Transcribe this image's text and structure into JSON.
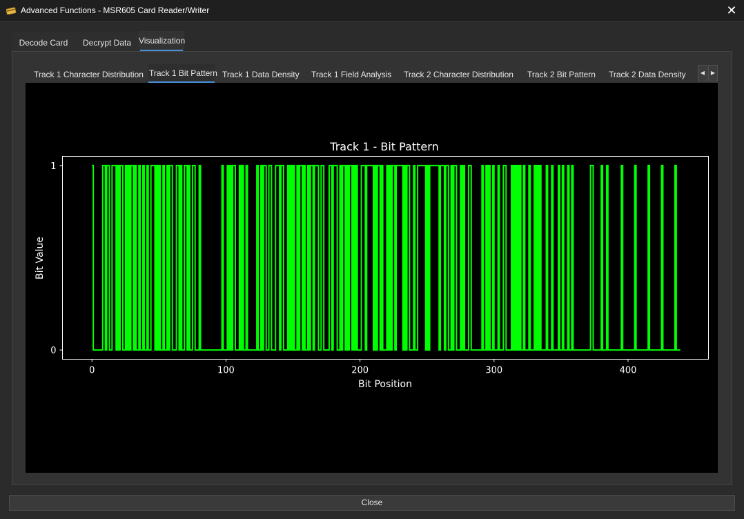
{
  "window": {
    "title": "Advanced Functions - MSR605 Card Reader/Writer",
    "icon": "card-icon",
    "close_icon": "close-icon"
  },
  "outer_tabs": [
    {
      "label": "Decode Card"
    },
    {
      "label": "Decrypt Data"
    },
    {
      "label": "Visualization",
      "active": true
    }
  ],
  "inner_tabs": [
    {
      "label": "Track 1 Character Distribution"
    },
    {
      "label": "Track 1 Bit Pattern",
      "active": true
    },
    {
      "label": "Track 1 Data Density"
    },
    {
      "label": "Track 1 Field Analysis"
    },
    {
      "label": "Track 2 Character Distribution"
    },
    {
      "label": "Track 2 Bit Pattern"
    },
    {
      "label": "Track 2 Data Density"
    }
  ],
  "scroll_buttons": {
    "left_icon": "triangle-left-icon",
    "right_icon": "triangle-right-icon"
  },
  "footer": {
    "close_label": "Close"
  },
  "colors": {
    "line": "#00ff00",
    "background": "#000000",
    "accent": "#4a90d9"
  },
  "chart_data": {
    "type": "line",
    "step": true,
    "title": "Track 1 - Bit Pattern",
    "xlabel": "Bit Position",
    "ylabel": "Bit Value",
    "xlim": [
      -22,
      460
    ],
    "ylim": [
      -0.05,
      1.05
    ],
    "xticks": [
      0,
      100,
      200,
      300,
      400
    ],
    "yticks": [
      0,
      1
    ],
    "grid": false,
    "line_color": "#00ff00",
    "x": [
      0,
      1,
      2,
      3,
      4,
      5,
      6,
      7,
      8,
      9,
      10,
      11,
      12,
      13,
      14,
      15,
      16,
      17,
      18,
      19,
      20,
      21,
      22,
      23,
      24,
      25,
      26,
      27,
      28,
      29,
      30,
      31,
      32,
      33,
      34,
      35,
      36,
      37,
      38,
      39,
      40,
      41,
      42,
      43,
      44,
      45,
      46,
      47,
      48,
      49,
      50,
      51,
      52,
      53,
      54,
      55,
      56,
      57,
      58,
      59,
      60,
      61,
      62,
      63,
      64,
      65,
      66,
      67,
      68,
      69,
      70,
      71,
      72,
      73,
      74,
      75,
      76,
      77,
      78,
      79,
      80,
      81,
      82,
      83,
      84,
      85,
      86,
      87,
      88,
      89,
      90,
      91,
      92,
      93,
      94,
      95,
      96,
      97,
      98,
      99,
      100,
      101,
      102,
      103,
      104,
      105,
      106,
      107,
      108,
      109,
      110,
      111,
      112,
      113,
      114,
      115,
      116,
      117,
      118,
      119,
      120,
      121,
      122,
      123,
      124,
      125,
      126,
      127,
      128,
      129,
      130,
      131,
      132,
      133,
      134,
      135,
      136,
      137,
      138,
      139,
      140,
      141,
      142,
      143,
      144,
      145,
      146,
      147,
      148,
      149,
      150,
      151,
      152,
      153,
      154,
      155,
      156,
      157,
      158,
      159,
      160,
      161,
      162,
      163,
      164,
      165,
      166,
      167,
      168,
      169,
      170,
      171,
      172,
      173,
      174,
      175,
      176,
      177,
      178,
      179,
      180,
      181,
      182,
      183,
      184,
      185,
      186,
      187,
      188,
      189,
      190,
      191,
      192,
      193,
      194,
      195,
      196,
      197,
      198,
      199,
      200,
      201,
      202,
      203,
      204,
      205,
      206,
      207,
      208,
      209,
      210,
      211,
      212,
      213,
      214,
      215,
      216,
      217,
      218,
      219,
      220,
      221,
      222,
      223,
      224,
      225,
      226,
      227,
      228,
      229,
      230,
      231,
      232,
      233,
      234,
      235,
      236,
      237,
      238,
      239,
      240,
      241,
      242,
      243,
      244,
      245,
      246,
      247,
      248,
      249,
      250,
      251,
      252,
      253,
      254,
      255,
      256,
      257,
      258,
      259,
      260,
      261,
      262,
      263,
      264,
      265,
      266,
      267,
      268,
      269,
      270,
      271,
      272,
      273,
      274,
      275,
      276,
      277,
      278,
      279,
      280,
      281,
      282,
      283,
      284,
      285,
      286,
      287,
      288,
      289,
      290,
      291,
      292,
      293,
      294,
      295,
      296,
      297,
      298,
      299,
      300,
      301,
      302,
      303,
      304,
      305,
      306,
      307,
      308,
      309,
      310,
      311,
      312,
      313,
      314,
      315,
      316,
      317,
      318,
      319,
      320,
      321,
      322,
      323,
      324,
      325,
      326,
      327,
      328,
      329,
      330,
      331,
      332,
      333,
      334,
      335,
      336,
      337,
      338,
      339,
      340,
      341,
      342,
      343,
      344,
      345,
      346,
      347,
      348,
      349,
      350,
      351,
      352,
      353,
      354,
      355,
      356,
      357,
      358,
      359,
      360,
      361,
      362,
      363,
      364,
      365,
      366,
      367,
      368,
      369,
      370,
      371,
      372,
      373,
      374,
      375,
      376,
      377,
      378,
      379,
      380,
      381,
      382,
      383,
      384,
      385,
      386,
      387,
      388,
      389,
      390,
      391,
      392,
      393,
      394,
      395,
      396,
      397,
      398,
      399,
      400,
      401,
      402,
      403,
      404,
      405,
      406,
      407,
      408,
      409,
      410,
      411,
      412,
      413,
      414,
      415,
      416,
      417,
      418,
      419,
      420,
      421,
      422,
      423,
      424,
      425,
      426,
      427,
      428,
      429,
      430,
      431,
      432,
      433,
      434,
      435,
      436,
      437,
      438,
      439
    ],
    "y": [
      1,
      0,
      0,
      0,
      0,
      0,
      0,
      0,
      1,
      1,
      0,
      1,
      1,
      0,
      0,
      1,
      1,
      1,
      0,
      1,
      0,
      1,
      1,
      0,
      0,
      1,
      0,
      1,
      0,
      1,
      1,
      0,
      1,
      0,
      0,
      1,
      0,
      0,
      1,
      0,
      0,
      1,
      0,
      0,
      1,
      1,
      1,
      0,
      1,
      0,
      1,
      0,
      0,
      1,
      0,
      0,
      1,
      0,
      1,
      1,
      0,
      0,
      0,
      1,
      1,
      0,
      1,
      0,
      0,
      1,
      1,
      0,
      1,
      0,
      0,
      1,
      1,
      0,
      0,
      0,
      1,
      0,
      0,
      0,
      0,
      0,
      0,
      0,
      0,
      0,
      0,
      0,
      0,
      0,
      0,
      0,
      0,
      1,
      0,
      0,
      0,
      1,
      0,
      1,
      0,
      1,
      1,
      0,
      0,
      0,
      1,
      0,
      1,
      0,
      0,
      1,
      0,
      0,
      0,
      0,
      0,
      0,
      0,
      1,
      0,
      0,
      1,
      0,
      1,
      1,
      0,
      0,
      1,
      1,
      0,
      0,
      0,
      1,
      1,
      1,
      0,
      1,
      1,
      0,
      0,
      0,
      1,
      0,
      1,
      0,
      1,
      0,
      0,
      1,
      0,
      1,
      1,
      0,
      1,
      0,
      0,
      1,
      0,
      1,
      1,
      0,
      1,
      1,
      1,
      0,
      0,
      1,
      1,
      0,
      0,
      0,
      0,
      1,
      1,
      0,
      1,
      1,
      1,
      0,
      0,
      1,
      0,
      1,
      1,
      0,
      1,
      0,
      1,
      1,
      0,
      1,
      0,
      1,
      0,
      0,
      0,
      1,
      1,
      1,
      0,
      1,
      1,
      1,
      1,
      1,
      0,
      1,
      0,
      1,
      1,
      0,
      1,
      0,
      0,
      0,
      1,
      0,
      1,
      0,
      1,
      1,
      0,
      1,
      1,
      1,
      1,
      1,
      0,
      1,
      0,
      1,
      1,
      0,
      0,
      0,
      1,
      0,
      0,
      1,
      1,
      1,
      1,
      1,
      1,
      0,
      1,
      0,
      1,
      1,
      1,
      1,
      1,
      1,
      1,
      0,
      1,
      1,
      1,
      0,
      1,
      1,
      0,
      0,
      1,
      0,
      1,
      1,
      0,
      0,
      0,
      1,
      0,
      1,
      0,
      0,
      0,
      1,
      1,
      0,
      0,
      0,
      0,
      0,
      0,
      0,
      0,
      1,
      0,
      0,
      1,
      0,
      1,
      0,
      0,
      1,
      0,
      0,
      0,
      1,
      0,
      0,
      0,
      1,
      1,
      0,
      0,
      0,
      0,
      1,
      0,
      1,
      0,
      1,
      0,
      1,
      0,
      0,
      1,
      0,
      0,
      0,
      1,
      0,
      0,
      0,
      1,
      0,
      1,
      0,
      1,
      0,
      0,
      0,
      0,
      1,
      0,
      0,
      0,
      1,
      0,
      0,
      0,
      0,
      1,
      0,
      0,
      1,
      0,
      0,
      0,
      1,
      0,
      0,
      1,
      0,
      0,
      0,
      0,
      0,
      0,
      0,
      0,
      0,
      0,
      0,
      0,
      0,
      1,
      1,
      0,
      0,
      0,
      0,
      0,
      0,
      1,
      0,
      0,
      0,
      1,
      0,
      0,
      0,
      0,
      0,
      0,
      0,
      0,
      0,
      0,
      1,
      0,
      0,
      0,
      0,
      0,
      0,
      0,
      0,
      0,
      1,
      0,
      0,
      0,
      0,
      0,
      0,
      0,
      0,
      0,
      1,
      0,
      0,
      0,
      0,
      0,
      0,
      0,
      0,
      0,
      1,
      0,
      0,
      0,
      0,
      0,
      0,
      0,
      0,
      0,
      1,
      0,
      0,
      0,
      0,
      0,
      0,
      0,
      0,
      0,
      1,
      0,
      0,
      0,
      0,
      0,
      0,
      0,
      0,
      0,
      1,
      0,
      0,
      0,
      0,
      0,
      0,
      0,
      0,
      0,
      1,
      0,
      0,
      0,
      0,
      0,
      0,
      0,
      0,
      0,
      1,
      0,
      0,
      0,
      0
    ]
  }
}
